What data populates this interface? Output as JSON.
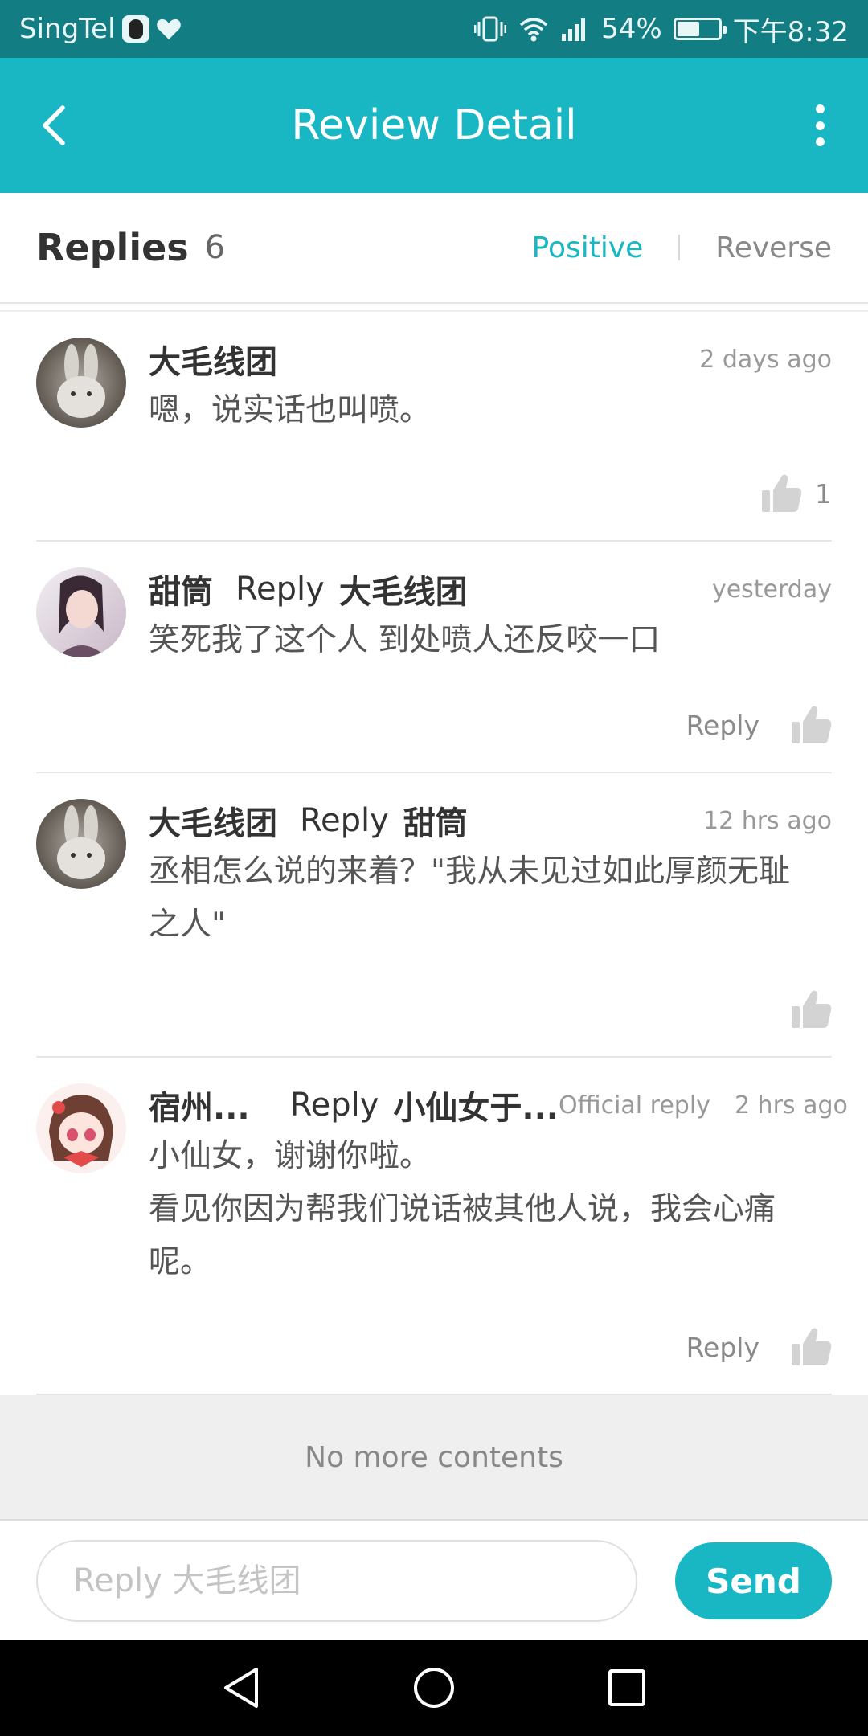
{
  "status_bar": {
    "carrier": "SingTel",
    "battery": "54%",
    "battery_level": 0.54,
    "time": "下午8:32"
  },
  "app_bar": {
    "title": "Review Detail",
    "back_icon": "back-arrow-icon",
    "more_icon": "more-vertical-icon"
  },
  "replies_header": {
    "title": "Replies",
    "count": "6",
    "sort_positive": "Positive",
    "sort_reverse": "Reverse"
  },
  "comments": [
    {
      "name": "大毛线团",
      "time": "2 days ago",
      "text": "嗯，说实话也叫喷。",
      "like_count": "1"
    },
    {
      "name": "甜筒",
      "reply_word": "Reply",
      "target": "大毛线团",
      "time": "yesterday",
      "text": "笑死我了这个人 到处喷人还反咬一口",
      "reply_label": "Reply"
    },
    {
      "name": "大毛线团",
      "reply_word": "Reply",
      "target": "甜筒",
      "time": "12 hrs ago",
      "text": "丞相怎么说的来着？\"我从未见过如此厚颜无耻之人\""
    },
    {
      "name": "宿州...",
      "reply_word": "Reply",
      "target": "小仙女于...",
      "official": "Official reply",
      "time": "2 hrs ago",
      "text_line1": "小仙女，谢谢你啦。",
      "text_line2": "看见你因为帮我们说话被其他人说，我会心痛呢。",
      "reply_label": "Reply"
    }
  ],
  "footer": {
    "no_more": "No more contents"
  },
  "input_bar": {
    "placeholder": "Reply 大毛线团",
    "send_label": "Send"
  },
  "colors": {
    "accent": "#19b6c4",
    "status_bar": "#137d84"
  }
}
